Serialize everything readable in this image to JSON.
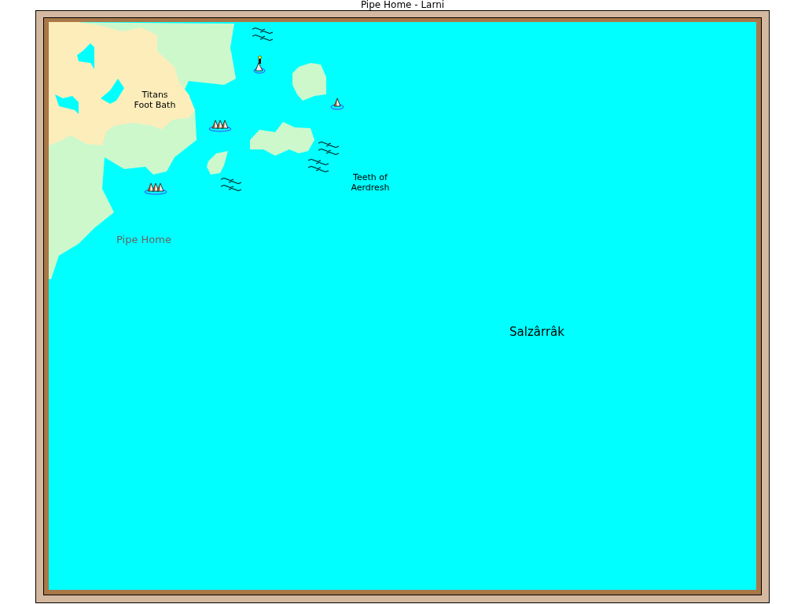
{
  "window": {
    "title": "Pipe Home - Larni"
  },
  "map": {
    "labels": [
      {
        "text": "Titans\nFoot Bath",
        "kind": "region"
      },
      {
        "text": "Teeth of\nAerdresh",
        "kind": "region"
      },
      {
        "text": "Pipe Home",
        "kind": "town"
      },
      {
        "text": "Salzârrâk",
        "kind": "sea"
      }
    ]
  }
}
